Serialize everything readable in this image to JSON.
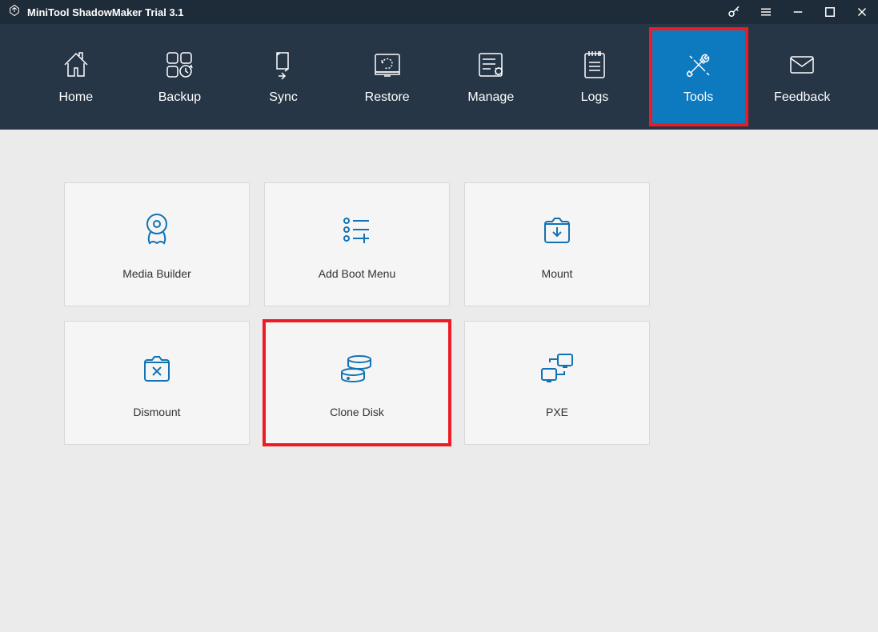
{
  "titlebar": {
    "title": "MiniTool ShadowMaker Trial 3.1"
  },
  "nav": {
    "items": [
      {
        "label": "Home"
      },
      {
        "label": "Backup"
      },
      {
        "label": "Sync"
      },
      {
        "label": "Restore"
      },
      {
        "label": "Manage"
      },
      {
        "label": "Logs"
      },
      {
        "label": "Tools"
      },
      {
        "label": "Feedback"
      }
    ]
  },
  "tools": {
    "items": [
      {
        "label": "Media Builder"
      },
      {
        "label": "Add Boot Menu"
      },
      {
        "label": "Mount"
      },
      {
        "label": "Dismount"
      },
      {
        "label": "Clone Disk"
      },
      {
        "label": "PXE"
      }
    ]
  }
}
